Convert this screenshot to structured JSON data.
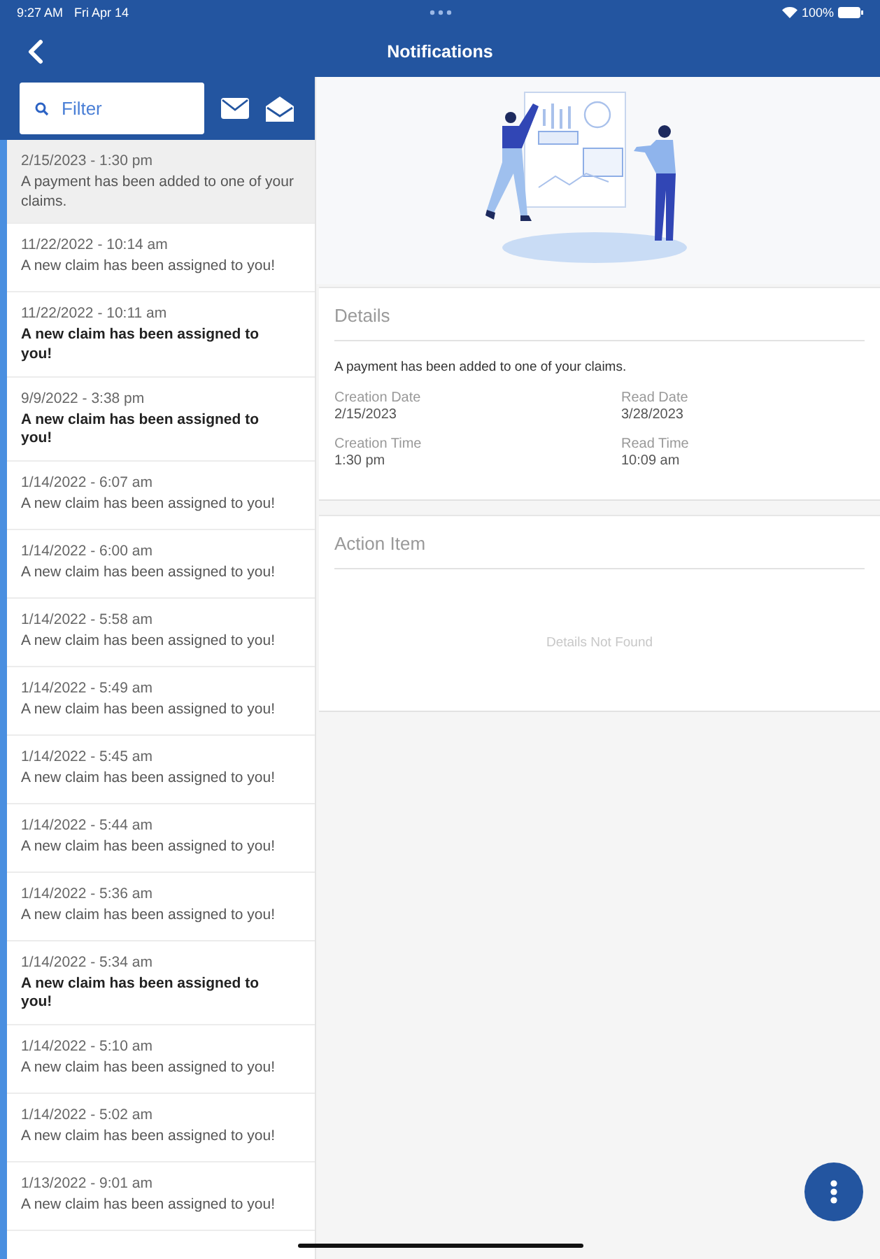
{
  "status_bar": {
    "time": "9:27 AM",
    "date": "Fri Apr 14",
    "battery": "100%"
  },
  "header": {
    "title": "Notifications"
  },
  "filter": {
    "placeholder": "Filter"
  },
  "notifications": [
    {
      "date": "2/15/2023 - 1:30 pm",
      "text": "A payment has been added to one of your claims.",
      "selected": true,
      "unread": false
    },
    {
      "date": "11/22/2022 - 10:14 am",
      "text": "A new claim has been assigned to you!",
      "selected": false,
      "unread": false
    },
    {
      "date": "11/22/2022 - 10:11 am",
      "text": "A new claim has been assigned to you!",
      "selected": false,
      "unread": true
    },
    {
      "date": "9/9/2022 - 3:38 pm",
      "text": "A new claim has been assigned to you!",
      "selected": false,
      "unread": true
    },
    {
      "date": "1/14/2022 - 6:07 am",
      "text": "A new claim has been assigned to you!",
      "selected": false,
      "unread": false
    },
    {
      "date": "1/14/2022 - 6:00 am",
      "text": "A new claim has been assigned to you!",
      "selected": false,
      "unread": false
    },
    {
      "date": "1/14/2022 - 5:58 am",
      "text": "A new claim has been assigned to you!",
      "selected": false,
      "unread": false
    },
    {
      "date": "1/14/2022 - 5:49 am",
      "text": "A new claim has been assigned to you!",
      "selected": false,
      "unread": false
    },
    {
      "date": "1/14/2022 - 5:45 am",
      "text": "A new claim has been assigned to you!",
      "selected": false,
      "unread": false
    },
    {
      "date": "1/14/2022 - 5:44 am",
      "text": "A new claim has been assigned to you!",
      "selected": false,
      "unread": false
    },
    {
      "date": "1/14/2022 - 5:36 am",
      "text": "A new claim has been assigned to you!",
      "selected": false,
      "unread": false
    },
    {
      "date": "1/14/2022 - 5:34 am",
      "text": "A new claim has been assigned to you!",
      "selected": false,
      "unread": true
    },
    {
      "date": "1/14/2022 - 5:10 am",
      "text": "A new claim has been assigned to you!",
      "selected": false,
      "unread": false
    },
    {
      "date": "1/14/2022 - 5:02 am",
      "text": "A new claim has been assigned to you!",
      "selected": false,
      "unread": false
    },
    {
      "date": "1/13/2022 - 9:01 am",
      "text": "A new claim has been assigned to you!",
      "selected": false,
      "unread": false
    }
  ],
  "details": {
    "title": "Details",
    "message": "A payment has been added to one of your claims.",
    "fields": [
      {
        "label": "Creation Date",
        "value": "2/15/2023"
      },
      {
        "label": "Read Date",
        "value": "3/28/2023"
      },
      {
        "label": "Creation Time",
        "value": "1:30 pm"
      },
      {
        "label": "Read Time",
        "value": "10:09 am"
      }
    ]
  },
  "action_item": {
    "title": "Action Item",
    "empty": "Details Not Found"
  }
}
